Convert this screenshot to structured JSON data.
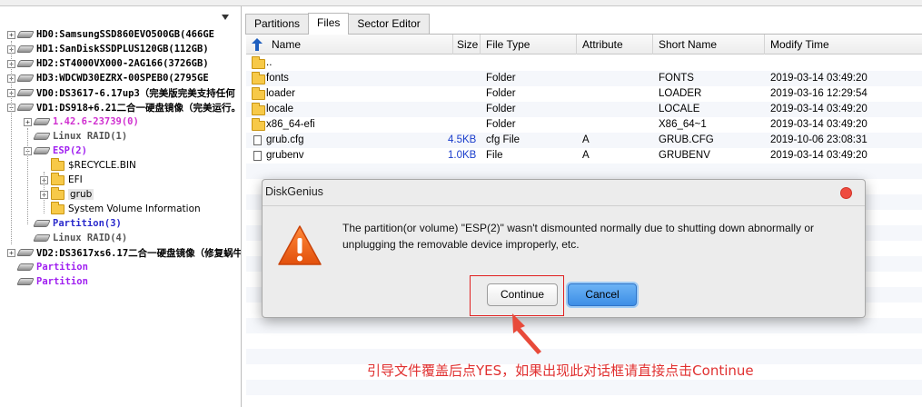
{
  "tree": {
    "items": [
      {
        "label": "HD0:SamsungSSD860EVO500GB(466GE",
        "exp": "+",
        "kind": "disk",
        "style": "bold"
      },
      {
        "label": "HD1:SanDiskSSDPLUS120GB(112GB)",
        "exp": "+",
        "kind": "disk",
        "style": "bold"
      },
      {
        "label": "HD2:ST4000VX000-2AG166(3726GB)",
        "exp": "+",
        "kind": "disk",
        "style": "bold"
      },
      {
        "label": "HD3:WDCWD30EZRX-00SPEB0(2795GE",
        "exp": "+",
        "kind": "disk",
        "style": "bold"
      },
      {
        "label": "VD0:DS3617-6.17up3（完美版完美支持任何",
        "exp": "+",
        "kind": "disk",
        "style": "bold"
      },
      {
        "label": "VD1:DS918+6.21二合一硬盘镜像（完美运行。",
        "exp": "-",
        "kind": "disk",
        "style": "bold"
      },
      {
        "label": "1.42.6-23739(0)",
        "exp": "+",
        "kind": "part",
        "style": "pink"
      },
      {
        "label": "Linux RAID(1)",
        "exp": "",
        "kind": "part",
        "style": "gray"
      },
      {
        "label": "ESP(2)",
        "exp": "-",
        "kind": "part",
        "style": "purple"
      },
      {
        "label": "$RECYCLE.BIN",
        "exp": "",
        "kind": "folder",
        "style": "plain"
      },
      {
        "label": "EFI",
        "exp": "+",
        "kind": "folder",
        "style": "plain"
      },
      {
        "label": "grub",
        "exp": "+",
        "kind": "folder",
        "style": "selected"
      },
      {
        "label": "System Volume Information",
        "exp": "",
        "kind": "folder",
        "style": "plain"
      },
      {
        "label": "Partition(3)",
        "exp": "",
        "kind": "part",
        "style": "navy"
      },
      {
        "label": "Linux RAID(4)",
        "exp": "",
        "kind": "part",
        "style": "gray"
      },
      {
        "label": "VD2:DS3617xs6.17二合一硬盘镜像（修复蜗牛",
        "exp": "+",
        "kind": "disk",
        "style": "bold"
      },
      {
        "label": "Partition",
        "exp": "",
        "kind": "part",
        "style": "purple"
      },
      {
        "label": "Partition",
        "exp": "",
        "kind": "part",
        "style": "purple"
      }
    ]
  },
  "tabs": [
    {
      "label": "Partitions",
      "active": false
    },
    {
      "label": "Files",
      "active": true
    },
    {
      "label": "Sector Editor",
      "active": false
    }
  ],
  "columns": {
    "name": "Name",
    "size": "Size",
    "type": "File Type",
    "attr": "Attribute",
    "short": "Short Name",
    "mtime": "Modify Time"
  },
  "files": [
    {
      "name": "..",
      "size": "",
      "type": "",
      "attr": "",
      "short": "",
      "mtime": "",
      "icon": "folder-icon"
    },
    {
      "name": "fonts",
      "size": "",
      "type": "Folder",
      "attr": "",
      "short": "FONTS",
      "mtime": "2019-03-14 03:49:20",
      "icon": "folder-icon"
    },
    {
      "name": "loader",
      "size": "",
      "type": "Folder",
      "attr": "",
      "short": "LOADER",
      "mtime": "2019-03-16 12:29:54",
      "icon": "folder-icon"
    },
    {
      "name": "locale",
      "size": "",
      "type": "Folder",
      "attr": "",
      "short": "LOCALE",
      "mtime": "2019-03-14 03:49:20",
      "icon": "folder-icon"
    },
    {
      "name": "x86_64-efi",
      "size": "",
      "type": "Folder",
      "attr": "",
      "short": "X86_64~1",
      "mtime": "2019-03-14 03:49:20",
      "icon": "folder-icon"
    },
    {
      "name": "grub.cfg",
      "size": "4.5KB",
      "type": "cfg File",
      "attr": "A",
      "short": "GRUB.CFG",
      "mtime": "2019-10-06 23:08:31",
      "icon": "file-icon"
    },
    {
      "name": "grubenv",
      "size": "1.0KB",
      "type": "File",
      "attr": "A",
      "short": "GRUBENV",
      "mtime": "2019-03-14 03:49:20",
      "icon": "file-icon"
    }
  ],
  "dialog": {
    "title": "DiskGenius",
    "message": "The partition(or volume) \"ESP(2)\" wasn't dismounted normally due to shutting down abnormally or unplugging the removable device improperly, etc.",
    "continue_label": "Continue",
    "cancel_label": "Cancel",
    "icon": "warning-icon"
  },
  "annotation": {
    "note": "引导文件覆盖后点YES，如果出现此对话框请直接点击Continue",
    "color": "#e03030"
  },
  "colors": {
    "accent_blue": "#3d8ee6",
    "close_red": "#ee4b3f",
    "size_blue": "#1a3dcc"
  }
}
